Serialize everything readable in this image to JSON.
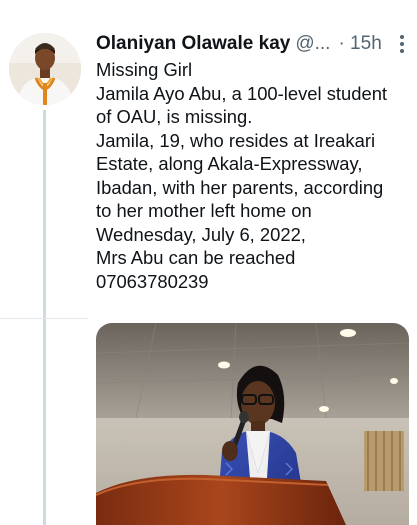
{
  "tweet": {
    "author_name": "Olaniyan Olawale kay",
    "handle": "@...",
    "time": "· 15h",
    "lines": [
      "Missing Girl",
      "Jamila Ayo Abu, a 100-level student",
      "of OAU, is missing.",
      "Jamila, 19, who resides at Ireakari",
      "Estate, along Akala-Expressway,",
      "Ibadan, with her parents, according",
      "to her mother left home on",
      "Wednesday, July 6, 2022,",
      "Mrs Abu can be reached",
      "07063780239"
    ]
  },
  "icons": {
    "more": "more-vertical-icon",
    "avatar": "avatar"
  },
  "colors": {
    "text": "#0f1419",
    "secondary": "#536471",
    "thread_line": "#cfd9de",
    "suit": "#2b3f9e"
  }
}
